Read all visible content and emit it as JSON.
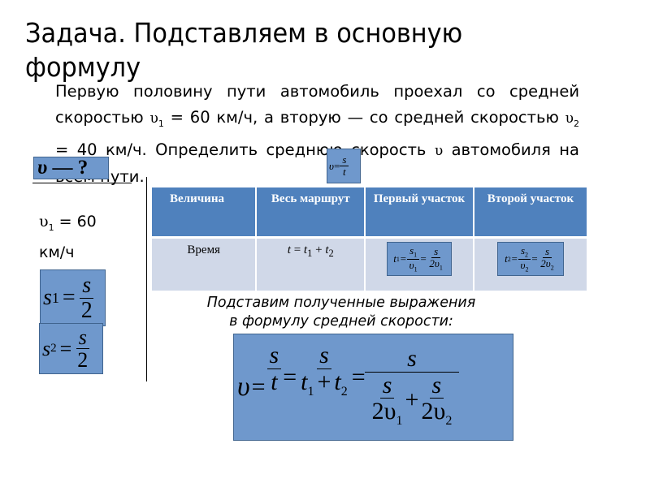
{
  "slide": {
    "title": "Задача. Подставляем в основную формулу",
    "problem": {
      "part1": "Первую половину пути автомобиль проехал со средней скоростью",
      "v1_symbol": "υ",
      "v1_sub": "1",
      "part2": "= 60 км/ч, а вторую — со средней скоростью",
      "v2_symbol": "υ",
      "v2_sub": "2",
      "part3": "= 40 км/ч. Определить среднюю скорость",
      "v_symbol": "υ",
      "part4": "автомобиля на всем пути."
    },
    "unknown_box": {
      "symbol": "υ",
      "text": " — ?"
    },
    "formula_box": {
      "lhs": "υ",
      "eq": "=",
      "num": "s",
      "den": "t"
    },
    "given": {
      "symbol": "υ",
      "sub": "1",
      "value": "= 60",
      "unit": "км/ч"
    },
    "s1_box": {
      "lhs": "s",
      "sub": "1",
      "eq": "=",
      "num": "s",
      "den": "2"
    },
    "s2_box": {
      "lhs": "s",
      "sub": "2",
      "eq": "=",
      "num": "s",
      "den": "2"
    },
    "table": {
      "headers": [
        "Величина",
        "Весь маршрут",
        "Первый участок",
        "Второй участок"
      ],
      "rows": [
        {
          "quantity": "Время",
          "whole": {
            "t": "t",
            "eq": " = ",
            "t1": "t",
            "s1": "1",
            "plus": " + ",
            "t2": "t",
            "s2": "2"
          },
          "first": {
            "lhs": "t",
            "lsub": "1",
            "n1": "s",
            "n1sub": "1",
            "d1": "υ",
            "d1sub": "1",
            "n2": "s",
            "d2": "2υ",
            "d2sub": "1"
          },
          "second": {
            "lhs": "t",
            "lsub": "2",
            "n1": "s",
            "n1sub": "2",
            "d1": "υ",
            "d1sub": "2",
            "n2": "s",
            "d2": "2υ",
            "d2sub": "2"
          }
        }
      ]
    },
    "caption_line1": "Подставим полученные выражения",
    "caption_line2": "в формулу средней скорости:",
    "main_formula": {
      "lhs": "υ",
      "eq": "=",
      "f1_num": "s",
      "f1_den": "t",
      "f2_num": "s",
      "f2_den_a": "t",
      "f2_den_a_sub": "1",
      "f2_plus": "+",
      "f2_den_b": "t",
      "f2_den_b_sub": "2",
      "f3_num": "s",
      "f3_a_num": "s",
      "f3_a_den": "2υ",
      "f3_a_sub": "1",
      "f3_plus": "+",
      "f3_b_num": "s",
      "f3_b_den": "2υ",
      "f3_b_sub": "2"
    },
    "colors": {
      "box_fill": "#6f98cc",
      "header_fill": "#4f81bd",
      "row_fill": "#d0d8e8"
    }
  }
}
